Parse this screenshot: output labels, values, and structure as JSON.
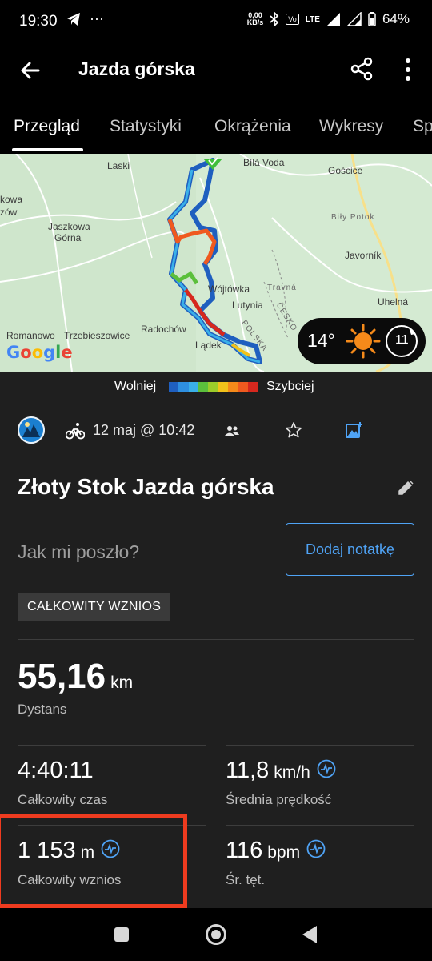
{
  "status_bar": {
    "time": "19:30",
    "net_speed": "0,00",
    "net_unit": "KB/s",
    "lte": "LTE",
    "battery": "64%"
  },
  "app_bar": {
    "title": "Jazda górska"
  },
  "tabs": [
    {
      "label": "Przegląd",
      "active": true
    },
    {
      "label": "Statystyki"
    },
    {
      "label": "Okrążenia"
    },
    {
      "label": "Wykresy"
    },
    {
      "label": "Sp"
    }
  ],
  "map": {
    "places": [
      "Laski",
      "Bílá Voda",
      "Gościce",
      "Jaszkowa",
      "Górna",
      "Biły Potok",
      "Javorník",
      "Wójtówka",
      "Travná",
      "Lutynia",
      "Uhelná",
      "Radochów",
      "Romanowo",
      "Trzebieszowice",
      "Lądek",
      "POLSKA",
      "ČESKO",
      "kowa",
      "zów"
    ],
    "attribution": "Google",
    "weather": {
      "temperature": "14°",
      "wind": "11"
    }
  },
  "legend": {
    "slow": "Wolniej",
    "fast": "Szybciej",
    "colors": [
      "#1f5fbf",
      "#2e8fe0",
      "#3ab0e8",
      "#5bbf3c",
      "#9ccc2a",
      "#f2c21a",
      "#f58a1a",
      "#ef5a1f",
      "#d6281e"
    ]
  },
  "activity": {
    "date": "12 maj @ 10:42",
    "title": "Złoty Stok Jazda górska",
    "note_prompt": "Jak mi poszło?",
    "note_button": "Dodaj notatkę",
    "chip": "CAŁKOWITY WZNIOS"
  },
  "stats": {
    "distance": {
      "value": "55,16",
      "unit": "km",
      "label": "Dystans"
    },
    "total_time": {
      "value": "4:40:11",
      "label": "Całkowity czas"
    },
    "avg_speed": {
      "value": "11,8",
      "unit": "km/h",
      "label": "Średnia prędkość"
    },
    "total_ascent": {
      "value": "1 153",
      "unit": "m",
      "label": "Całkowity wznios"
    },
    "avg_hr": {
      "value": "116",
      "unit": "bpm",
      "label": "Śr. tęt."
    }
  },
  "accent_color": "#4fa3f5",
  "highlight_color": "#ee3b1f"
}
